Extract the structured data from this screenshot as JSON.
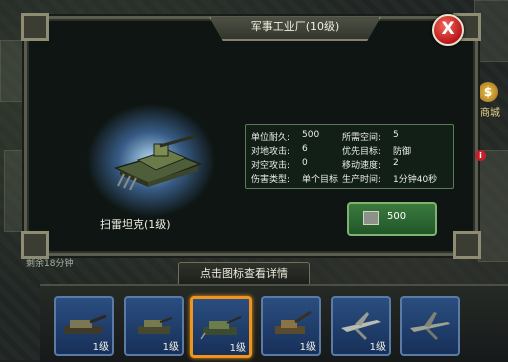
{
  "window": {
    "title": "军事工业厂(10级)",
    "close_label": "X"
  },
  "unit": {
    "name": "扫雷坦克(1级)"
  },
  "stats": {
    "durability_label": "单位耐久:",
    "durability_value": "500",
    "space_label": "所需空间:",
    "space_value": "5",
    "ground_attack_label": "对地攻击:",
    "ground_attack_value": "6",
    "priority_label": "优先目标:",
    "priority_value": "防御",
    "air_attack_label": "对空攻击:",
    "air_attack_value": "0",
    "speed_label": "移动速度:",
    "speed_value": "2",
    "damage_label": "伤害类型:",
    "damage_value": "单个目标",
    "time_label": "生产时间:",
    "time_value": "1分钟40秒"
  },
  "cost": {
    "amount": "500"
  },
  "hint": {
    "text": "点击图标查看详情"
  },
  "slots": [
    {
      "level": "1级",
      "icon": "heavy-tank-icon",
      "selected": false
    },
    {
      "level": "1级",
      "icon": "light-tank-icon",
      "selected": false
    },
    {
      "level": "1级",
      "icon": "mine-sweeper-tank-icon",
      "selected": true
    },
    {
      "level": "1级",
      "icon": "artillery-icon",
      "selected": false
    },
    {
      "level": "1级",
      "icon": "fighter-plane-icon",
      "selected": false
    },
    {
      "level": "",
      "icon": "bomber-plane-icon",
      "selected": false
    }
  ],
  "background": {
    "side_label": "商城",
    "bottom_text": "剩余18分钟"
  },
  "colors": {
    "accent": "#f0941b",
    "stat_border": "#5d7a56",
    "close_red": "#b8161a",
    "slot_blue": "#2a4e80"
  }
}
